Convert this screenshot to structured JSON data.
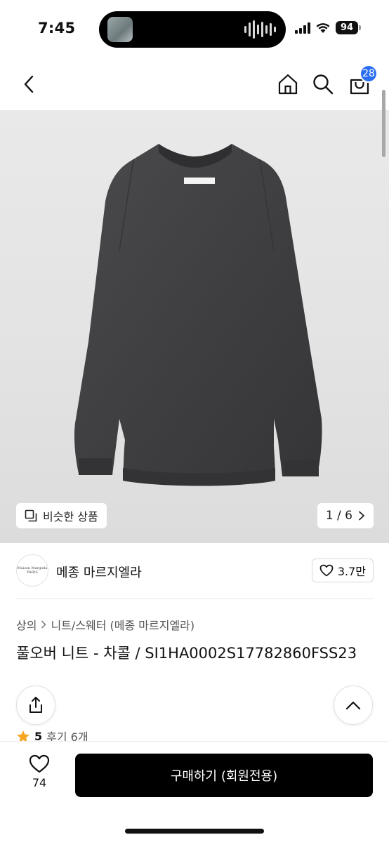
{
  "status_bar": {
    "time": "7:45",
    "battery": "94"
  },
  "header": {
    "back_icon": "chevron-left-icon",
    "home_icon": "home-icon",
    "search_icon": "search-icon",
    "cart_icon": "shopping-bag-icon",
    "cart_badge": "28",
    "badge_color": "#2b6ef2"
  },
  "product_image": {
    "similar_button_label": "비슷한 상품",
    "page_current": "1",
    "page_total": "6",
    "page_label": "1 / 6"
  },
  "brand": {
    "logo_text_line1": "Maison Margiela",
    "logo_text_line2": "PARIS",
    "name": "메종 마르지엘라",
    "likes": "3.7만"
  },
  "breadcrumb": {
    "category": "상의",
    "subcategory": "니트/스웨터 (메종 마르지엘라)"
  },
  "product": {
    "title": "풀오버 니트 - 차콜 / SI1HA0002S17782860FSS23",
    "rating": "5",
    "reviews": "후기 6개",
    "star_color": "#f5a623"
  },
  "bottom_bar": {
    "wish_count": "74",
    "buy_label": "구매하기 (회원전용)"
  }
}
